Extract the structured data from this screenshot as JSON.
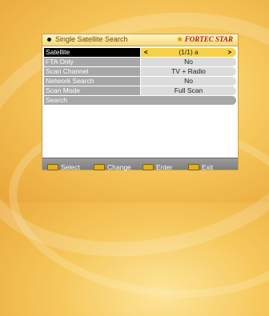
{
  "header": {
    "title": "Single Satellite Search",
    "brand": "FORTEC STAR"
  },
  "menu": [
    {
      "label": "Satellite",
      "value": "(1/1) a",
      "active": true
    },
    {
      "label": "FTA Only",
      "value": "No"
    },
    {
      "label": "Scan Channel",
      "value": "TV + Radio"
    },
    {
      "label": "Network Search",
      "value": "No"
    },
    {
      "label": "Scan Mode",
      "value": "Full Scan"
    },
    {
      "label": "Search",
      "value": ""
    }
  ],
  "arrows": {
    "left": "<",
    "right": ">"
  },
  "footer": [
    {
      "label": "Select"
    },
    {
      "label": "Change"
    },
    {
      "label": "Enter"
    },
    {
      "label": "Exit"
    }
  ]
}
